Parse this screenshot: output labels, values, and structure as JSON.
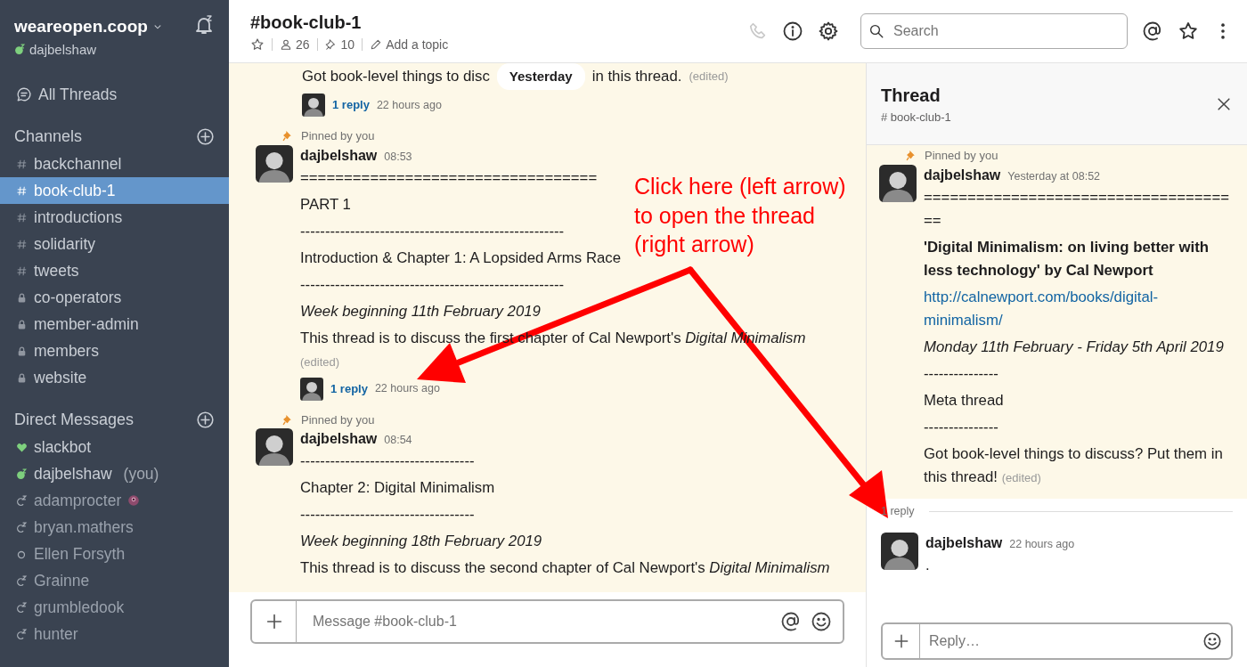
{
  "workspace": {
    "name": "weareopen.coop",
    "user": {
      "name": "dajbelshaw",
      "kind": "active_snooze"
    }
  },
  "sidebar": {
    "all_threads": "All Threads",
    "channels_heading": "Channels",
    "channels": [
      {
        "name": "backchannel",
        "kind": "public",
        "selected": false
      },
      {
        "name": "book-club-1",
        "kind": "public",
        "selected": true
      },
      {
        "name": "introductions",
        "kind": "public",
        "selected": false
      },
      {
        "name": "solidarity",
        "kind": "public",
        "selected": false
      },
      {
        "name": "tweets",
        "kind": "public",
        "selected": false
      },
      {
        "name": "co-operators",
        "kind": "private",
        "selected": false
      },
      {
        "name": "member-admin",
        "kind": "private",
        "selected": false
      },
      {
        "name": "members",
        "kind": "private",
        "selected": false
      },
      {
        "name": "website",
        "kind": "private",
        "selected": false
      }
    ],
    "dm_heading": "Direct Messages",
    "direct_messages": [
      {
        "name": "slackbot",
        "kind": "heart"
      },
      {
        "name": "dajbelshaw",
        "note": "(you)",
        "kind": "active_snooze"
      },
      {
        "name": "adamprocter",
        "kind": "away_snooze",
        "custom_status": true
      },
      {
        "name": "bryan.mathers",
        "kind": "away_snooze"
      },
      {
        "name": "Ellen Forsyth",
        "kind": "offline"
      },
      {
        "name": "Grainne",
        "kind": "away_snooze"
      },
      {
        "name": "grumbledook",
        "kind": "away_snooze"
      },
      {
        "name": "hunter",
        "kind": "away_snooze"
      }
    ]
  },
  "channel_header": {
    "title": "#book-club-1",
    "members": "26",
    "pins": "10",
    "topic": "Add a topic"
  },
  "search": {
    "placeholder": "Search"
  },
  "date_divider": "Yesterday",
  "messages": [
    {
      "kind": "partial",
      "fragments": [
        "Got book-level things to disc",
        "in this thread."
      ],
      "edited": "(edited)",
      "replies": {
        "count": "1 reply",
        "time": "22 hours ago"
      }
    },
    {
      "kind": "full",
      "pinned": "Pinned by you",
      "author": "dajbelshaw",
      "time": "08:53",
      "lines": [
        {
          "kind": "plain",
          "text": "=================================="
        },
        {
          "kind": "plain",
          "text": "PART 1"
        },
        {
          "kind": "plain",
          "text": "-----------------------------------------------------"
        },
        {
          "kind": "plain",
          "text": "Introduction & Chapter 1: A Lopsided Arms Race"
        },
        {
          "kind": "plain",
          "text": "-----------------------------------------------------"
        },
        {
          "kind": "italic",
          "text": "Week beginning 11th February 2019"
        },
        {
          "kind": "plain",
          "text": "This thread is to discuss the first chapter of Cal Newport's *Digital Minimalism*",
          "edited": "(edited)"
        }
      ],
      "replies": {
        "count": "1 reply",
        "time": "22 hours ago"
      }
    },
    {
      "kind": "full",
      "pinned": "Pinned by you",
      "author": "dajbelshaw",
      "time": "08:54",
      "lines": [
        {
          "kind": "plain",
          "text": "-----------------------------------"
        },
        {
          "kind": "plain",
          "text": "Chapter 2: Digital Minimalism"
        },
        {
          "kind": "plain",
          "text": "-----------------------------------"
        },
        {
          "kind": "italic",
          "text": "Week beginning 18th February 2019"
        },
        {
          "kind": "plain",
          "text": "This thread is to discuss the second chapter of Cal Newport's *Digital Minimalism*"
        }
      ]
    }
  ],
  "composer": {
    "placeholder": "Message #book-club-1"
  },
  "thread": {
    "title": "Thread",
    "channel": "# book-club-1",
    "parent": {
      "pinned": "Pinned by you",
      "author": "dajbelshaw",
      "time": "Yesterday at 08:52",
      "lines": [
        {
          "kind": "rule",
          "text": "====================================="
        },
        {
          "kind": "bold",
          "text": "'Digital Minimalism: on living better with less technology' by Cal Newport"
        },
        {
          "kind": "link",
          "text": "http://calnewport.com/books/digital-minimalism/"
        },
        {
          "kind": "italic",
          "text": "Monday 11th February - Friday 5th April 2019"
        },
        {
          "kind": "plain",
          "text": "---------------"
        },
        {
          "kind": "plain",
          "text": "Meta thread"
        },
        {
          "kind": "plain",
          "text": "---------------"
        },
        {
          "kind": "plain",
          "text": "Got book-level things to discuss? Put them in this thread!",
          "edited": "(edited)"
        }
      ]
    },
    "reply_count": "1 reply",
    "replies": [
      {
        "author": "dajbelshaw",
        "time": "22 hours ago",
        "text": "."
      }
    ],
    "composer": {
      "placeholder": "Reply…"
    }
  },
  "annotation": {
    "lines": [
      "Click here (left arrow)",
      "to open the thread",
      "(right arrow)"
    ]
  }
}
